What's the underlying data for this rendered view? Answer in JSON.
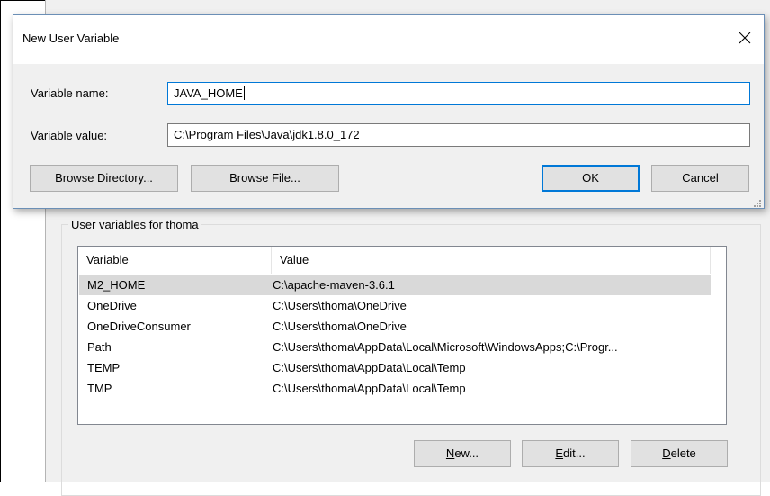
{
  "dialog": {
    "title": "New User Variable",
    "close_glyph": "✕",
    "name_label": "Variable name:",
    "name_value": "JAVA_HOME",
    "value_label": "Variable value:",
    "value_value": "C:\\Program Files\\Java\\jdk1.8.0_172",
    "buttons": {
      "browse_directory": "Browse Directory...",
      "browse_file": "Browse File...",
      "ok": "OK",
      "cancel": "Cancel"
    }
  },
  "user_vars": {
    "group_label_accel": "U",
    "group_label_rest": "ser variables for thoma",
    "columns": [
      "Variable",
      "Value"
    ],
    "rows": [
      {
        "variable": "M2_HOME",
        "value": "C:\\apache-maven-3.6.1",
        "selected": true
      },
      {
        "variable": "OneDrive",
        "value": "C:\\Users\\thoma\\OneDrive"
      },
      {
        "variable": "OneDriveConsumer",
        "value": "C:\\Users\\thoma\\OneDrive"
      },
      {
        "variable": "Path",
        "value": "C:\\Users\\thoma\\AppData\\Local\\Microsoft\\WindowsApps;C:\\Progr..."
      },
      {
        "variable": "TEMP",
        "value": "C:\\Users\\thoma\\AppData\\Local\\Temp"
      },
      {
        "variable": "TMP",
        "value": "C:\\Users\\thoma\\AppData\\Local\\Temp"
      }
    ],
    "buttons": {
      "new_accel": "N",
      "new_rest": "ew...",
      "edit_accel": "E",
      "edit_rest": "dit...",
      "delete_accel": "D",
      "delete_rest": "elete"
    }
  },
  "colors": {
    "accent": "#0078d7",
    "selected_row": "#d9d9d9",
    "window_bg": "#f0f0f0"
  }
}
